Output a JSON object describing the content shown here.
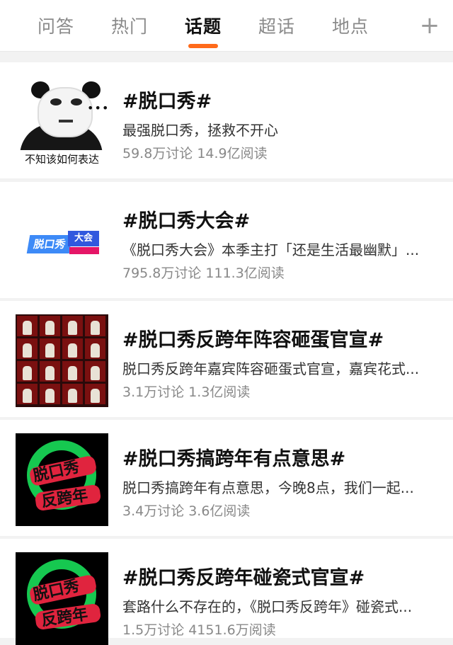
{
  "tabs": [
    {
      "label": "问答"
    },
    {
      "label": "热门"
    },
    {
      "label": "话题",
      "active": true
    },
    {
      "label": "超话"
    },
    {
      "label": "地点"
    }
  ],
  "plus_icon": "plus-icon",
  "items": [
    {
      "title": "#脱口秀#",
      "desc": "最强脱口秀，拯救不开心",
      "discussions": "59.8万讨论",
      "reads": "14.9亿阅读",
      "thumb_caption": "不知该如何表达"
    },
    {
      "title": "#脱口秀大会#",
      "desc": "《脱口秀大会》本季主打「还是生活最幽默」...",
      "discussions": "795.8万讨论",
      "reads": "111.3亿阅读",
      "thumb_logo_a": "脱口秀",
      "thumb_logo_b": "大会"
    },
    {
      "title": "#脱口秀反跨年阵容砸蛋官宣#",
      "desc": "脱口秀反跨年嘉宾阵容砸蛋式官宣，嘉宾花式...",
      "discussions": "3.1万讨论",
      "reads": "1.3亿阅读"
    },
    {
      "title": "#脱口秀搞跨年有点意思#",
      "desc": "脱口秀搞跨年有点意思，今晚8点，我们一起...",
      "discussions": "3.4万讨论",
      "reads": "3.6亿阅读",
      "thumb_logo_a": "脱口秀",
      "thumb_logo_b": "反跨年"
    },
    {
      "title": "#脱口秀反跨年碰瓷式官宣#",
      "desc": "套路什么不存在的，《脱口秀反跨年》碰瓷式...",
      "discussions": "1.5万讨论",
      "reads": "4151.6万阅读",
      "thumb_logo_a": "脱口秀",
      "thumb_logo_b": "反跨年"
    }
  ],
  "colors": {
    "accent": "#ff6a1a",
    "green": "#16c850",
    "red": "#e0243e"
  }
}
